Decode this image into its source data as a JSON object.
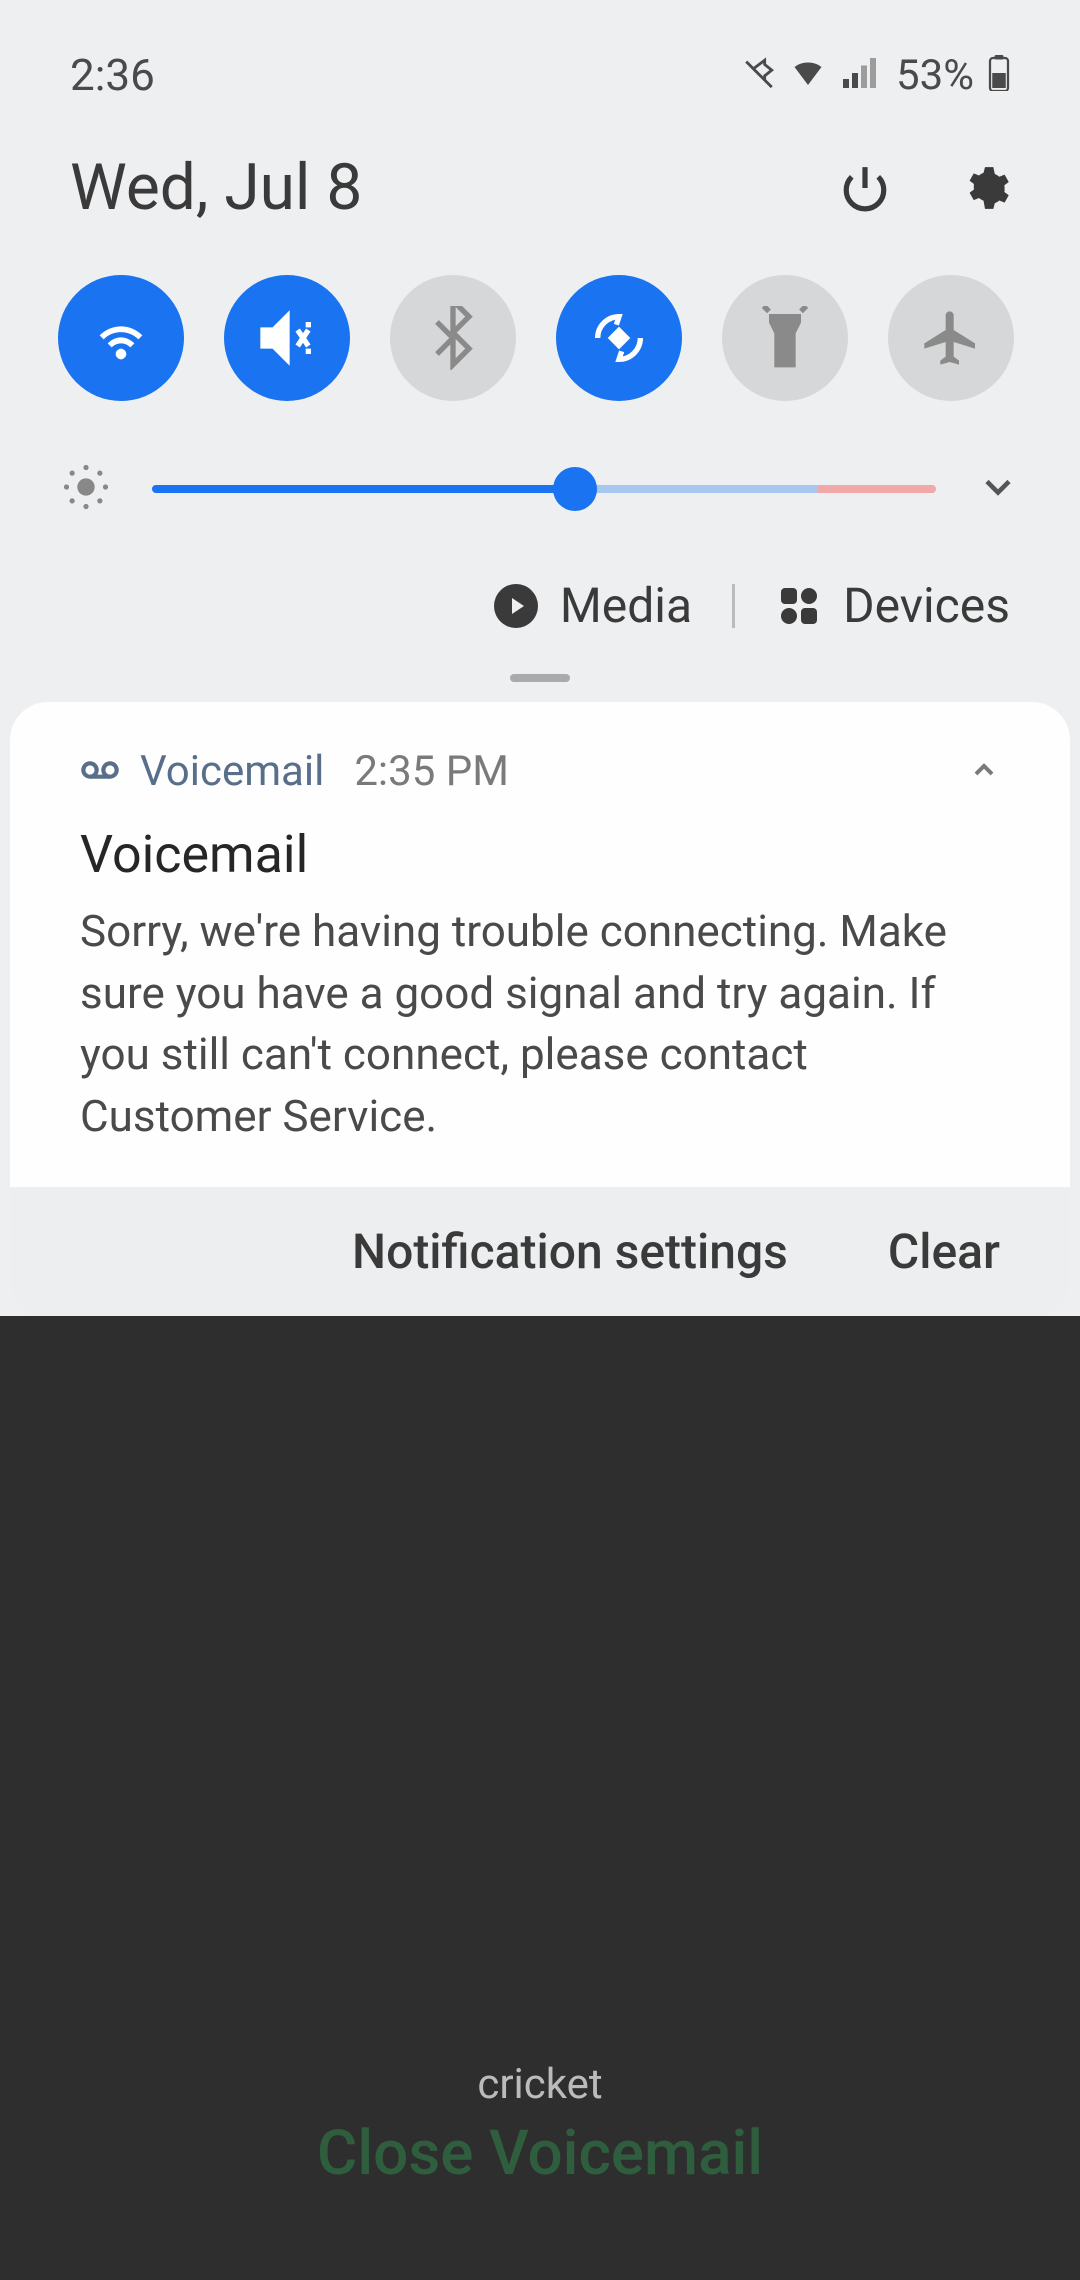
{
  "status_bar": {
    "time": "2:36",
    "battery_percent": "53%"
  },
  "header": {
    "date": "Wed, Jul 8"
  },
  "quick_settings": {
    "tiles": [
      {
        "name": "wifi",
        "active": true
      },
      {
        "name": "sound-mute",
        "active": true
      },
      {
        "name": "bluetooth",
        "active": false
      },
      {
        "name": "auto-rotate",
        "active": true
      },
      {
        "name": "flashlight",
        "active": false
      },
      {
        "name": "airplane",
        "active": false
      }
    ],
    "brightness_percent": 54
  },
  "media_row": {
    "media_label": "Media",
    "devices_label": "Devices"
  },
  "notification": {
    "app": "Voicemail",
    "time": "2:35 PM",
    "title": "Voicemail",
    "body": "Sorry, we're having trouble connecting. Make sure you have a good signal and try again. If you still can't connect, please contact Customer Service."
  },
  "notif_footer": {
    "settings_label": "Notification settings",
    "clear_label": "Clear"
  },
  "bottom": {
    "carrier": "cricket",
    "close_label": "Close Voicemail"
  },
  "colors": {
    "accent": "#1a73f0"
  }
}
